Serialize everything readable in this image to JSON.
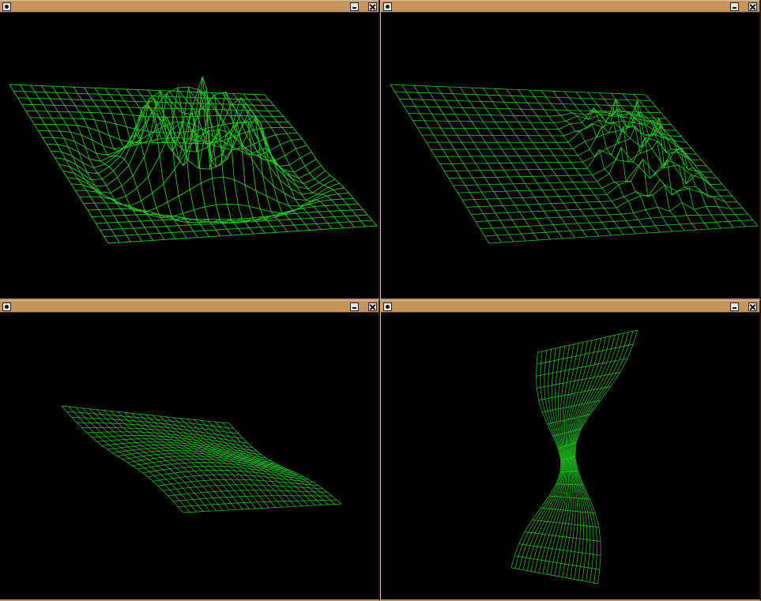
{
  "theme": {
    "titlebar_color": "#c4955d",
    "background_color": "#000000",
    "wire_color": "#22cc22"
  },
  "windows": [
    {
      "id": "top-left",
      "surface": "ripple",
      "buttons": {
        "menu": "window-menu-icon",
        "minimize": "minimize-icon",
        "close": "close-icon"
      }
    },
    {
      "id": "top-right",
      "surface": "noise-terrain",
      "buttons": {
        "menu": "window-menu-icon",
        "minimize": "minimize-icon",
        "close": "close-icon"
      }
    },
    {
      "id": "bottom-left",
      "surface": "wavy-sheet",
      "buttons": {
        "menu": "window-menu-icon",
        "minimize": "minimize-icon",
        "close": "close-icon"
      }
    },
    {
      "id": "bottom-right",
      "surface": "twisted-ruled-surface",
      "buttons": {
        "menu": "window-menu-icon",
        "minimize": "minimize-icon",
        "close": "close-icon"
      }
    }
  ]
}
